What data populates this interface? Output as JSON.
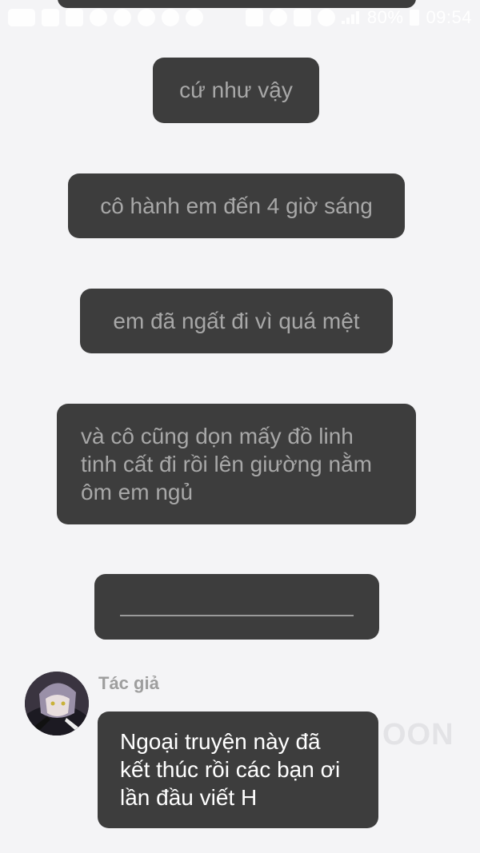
{
  "status_bar": {
    "battery_percent": "80%",
    "time": "09:54",
    "left_icons": [
      "message-icon",
      "gallery-icon",
      "chat-icon",
      "pinterest-icon",
      "shield-icon",
      "smile-icon",
      "gear-icon",
      "settings-icon"
    ],
    "right_icons": [
      "sim-icon",
      "mute-icon",
      "nfc-icon",
      "wifi-icon",
      "signal-icon",
      "battery-icon"
    ]
  },
  "messages": [
    {
      "text": "cứ như vậy"
    },
    {
      "text": "cô hành em đến 4 giờ sáng"
    },
    {
      "text": "em đã ngất đi vì quá mệt"
    },
    {
      "text": "và cô cũng dọn mấy đồ linh tinh cất đi rồi lên giường nằm ôm em ngủ"
    }
  ],
  "author_message": {
    "name": "Tác giả",
    "text": "Ngoại truyện này đã kết thúc rồi các bạn ơi lần đầu viết H"
  },
  "watermark": "OON",
  "colors": {
    "background": "#f4f4f6",
    "bubble": "#3d3d3d",
    "bubble_text": "#a8a8a8",
    "author_text": "#ffffff"
  }
}
